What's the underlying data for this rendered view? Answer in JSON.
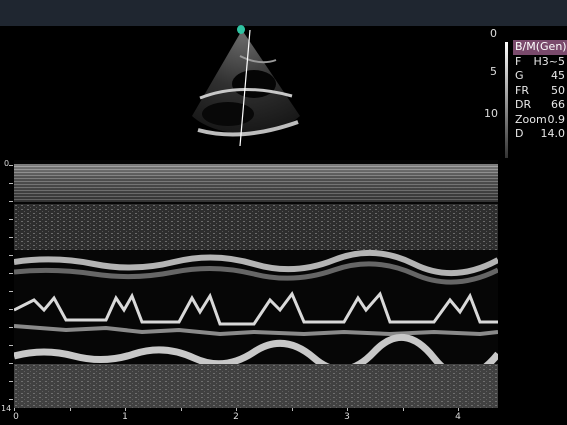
{
  "colors": {
    "topbar": "#1f2630",
    "mode_badge": "#7a4a6c",
    "orientation_marker": "#2fc3a2"
  },
  "depth_scale": {
    "labels": [
      "0",
      "5",
      "10"
    ]
  },
  "params": {
    "mode": "B/M(Gen)",
    "rows": [
      {
        "key": "F",
        "value": "H3~5"
      },
      {
        "key": "G",
        "value": "45"
      },
      {
        "key": "FR",
        "value": "50"
      },
      {
        "key": "DR",
        "value": "66"
      },
      {
        "key": "Zoom",
        "value": "0.9"
      },
      {
        "key": "D",
        "value": "14.0"
      }
    ]
  },
  "mmode": {
    "depth_top": "0",
    "depth_bottom": "14",
    "time_labels": [
      "0",
      "1",
      "2",
      "3",
      "4"
    ]
  },
  "icons": {
    "orientation_marker": "orientation-dot-icon"
  }
}
